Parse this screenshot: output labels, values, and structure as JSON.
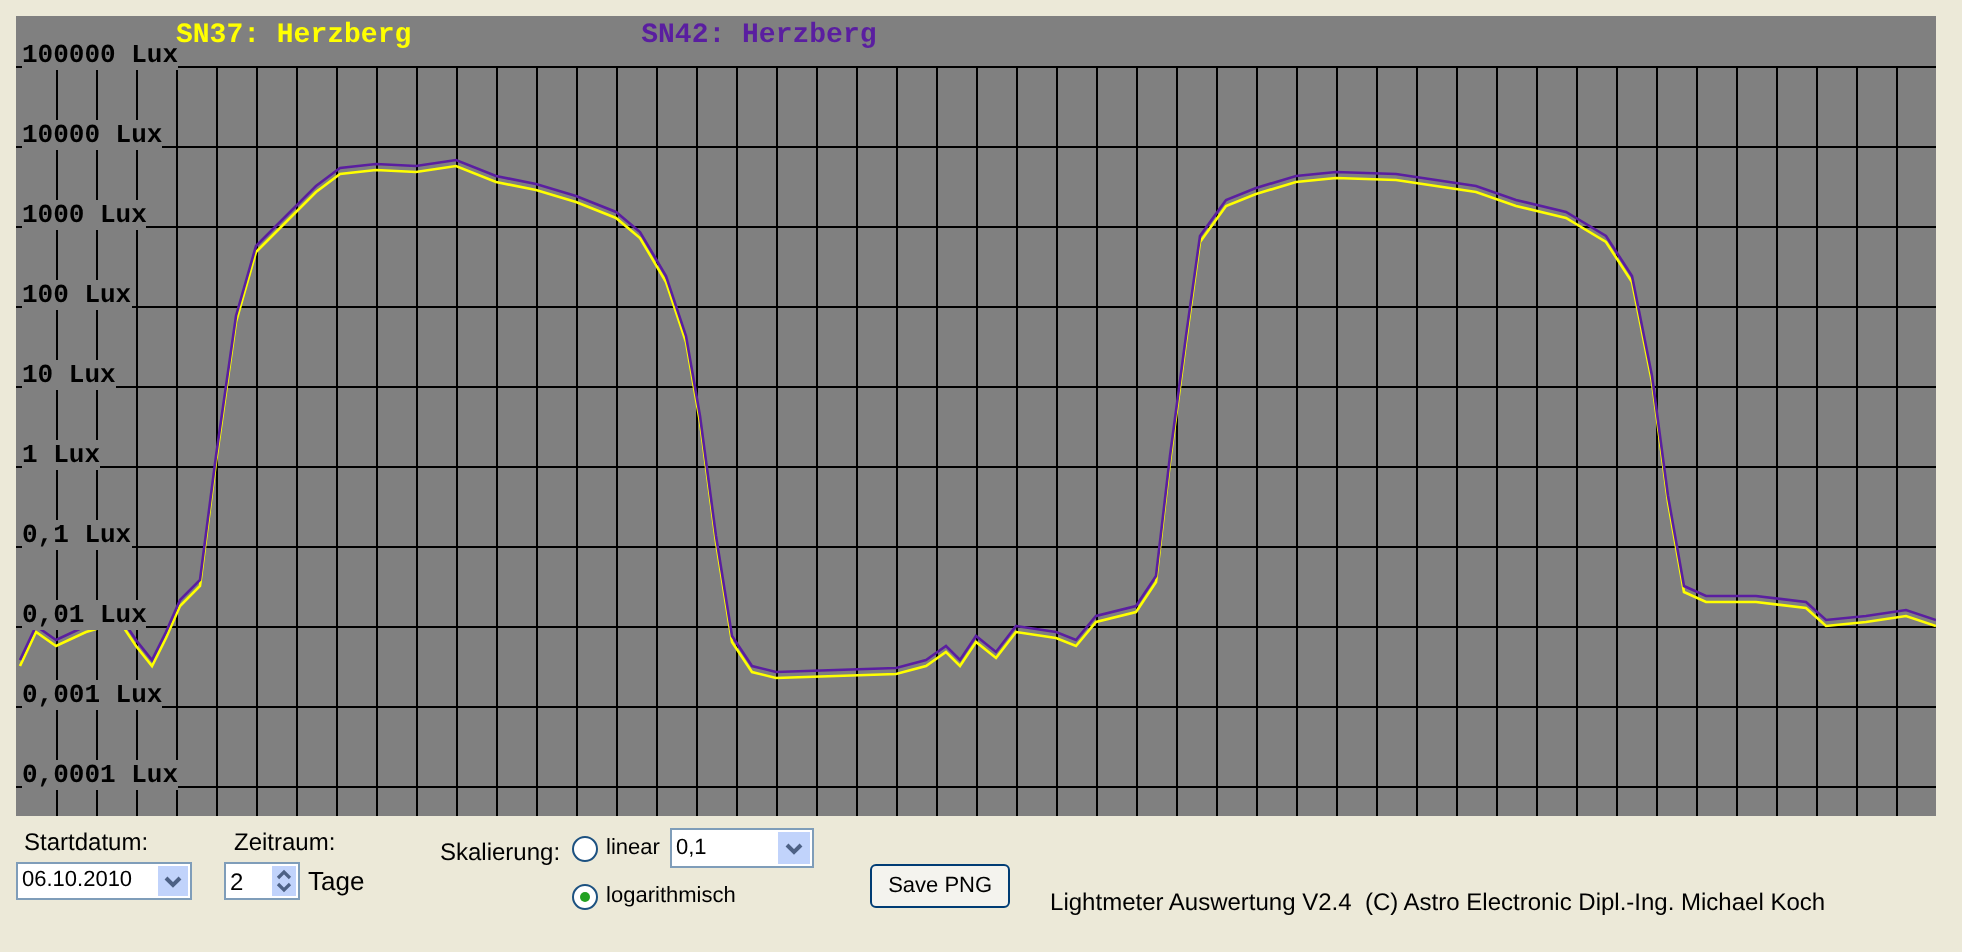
{
  "chart": {
    "legend": [
      {
        "label": "SN37: Herzberg",
        "color": "#ffff00"
      },
      {
        "label": "SN42: Herzberg",
        "color": "#5a1ea0"
      }
    ],
    "y_labels": [
      "100000 Lux",
      "10000 Lux",
      "1000 Lux",
      "100 Lux",
      "10 Lux",
      "1 Lux",
      "0,1 Lux",
      "0,01 Lux",
      "0,001 Lux",
      "0,0001 Lux"
    ]
  },
  "controls": {
    "start_date": {
      "label": "Startdatum:",
      "value": "06.10.2010"
    },
    "period": {
      "label": "Zeitraum:",
      "value": "2",
      "unit": "Tage"
    },
    "scaling": {
      "label": "Skalierung:",
      "options": [
        {
          "label": "linear",
          "selected": false
        },
        {
          "label": "logarithmisch",
          "selected": true
        }
      ],
      "linear_value": "0,1"
    },
    "save_button": "Save PNG",
    "credits": "Lightmeter Auswertung V2.4  (C) Astro Electronic Dipl.-Ing. Michael Koch"
  }
}
